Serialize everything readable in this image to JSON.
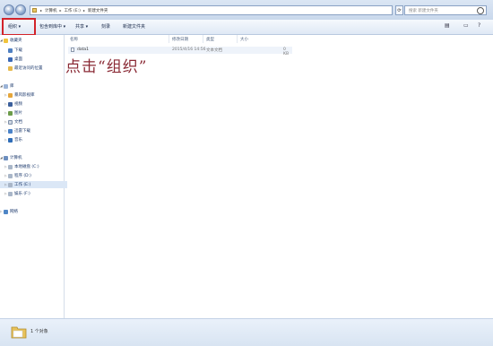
{
  "address": {
    "crumbs": [
      "计算机",
      "工作 (E:)",
      "新建文件夹"
    ],
    "search_placeholder": "搜索 新建文件夹"
  },
  "toolbar": {
    "organize": "组织 ▾",
    "include_in_library": "包含到库中 ▾",
    "share": "共享 ▾",
    "burn": "刻录",
    "new_folder": "新建文件夹"
  },
  "sidebar": {
    "favorites": "收藏夹",
    "downloads": "下载",
    "desktop": "桌面",
    "recent": "最近访问的位置",
    "libraries": "库",
    "videos": "暴风影视库",
    "pictures": "视频",
    "images": "图片",
    "documents": "文档",
    "thunder": "迅雷下载",
    "music": "音乐",
    "computer": "计算机",
    "local_c": "本地磁盘 (C:)",
    "program_d": "程序 (D:)",
    "work_e": "工作 (E:)",
    "entertain_f": "娱乐 (F:)",
    "network": "网络"
  },
  "columns": {
    "name": "名称",
    "modified": "修改日期",
    "type": "类型",
    "size": "大小"
  },
  "files": [
    {
      "name": "data1",
      "modified": "2015/4/16 14:56",
      "type": "文本文档",
      "size": "0 KB"
    }
  ],
  "annotation": "点击“组织”",
  "status": {
    "count": "1 个对象"
  },
  "colors": {
    "highlight_box": "#d2232a",
    "annotation": "#8a2a35"
  }
}
